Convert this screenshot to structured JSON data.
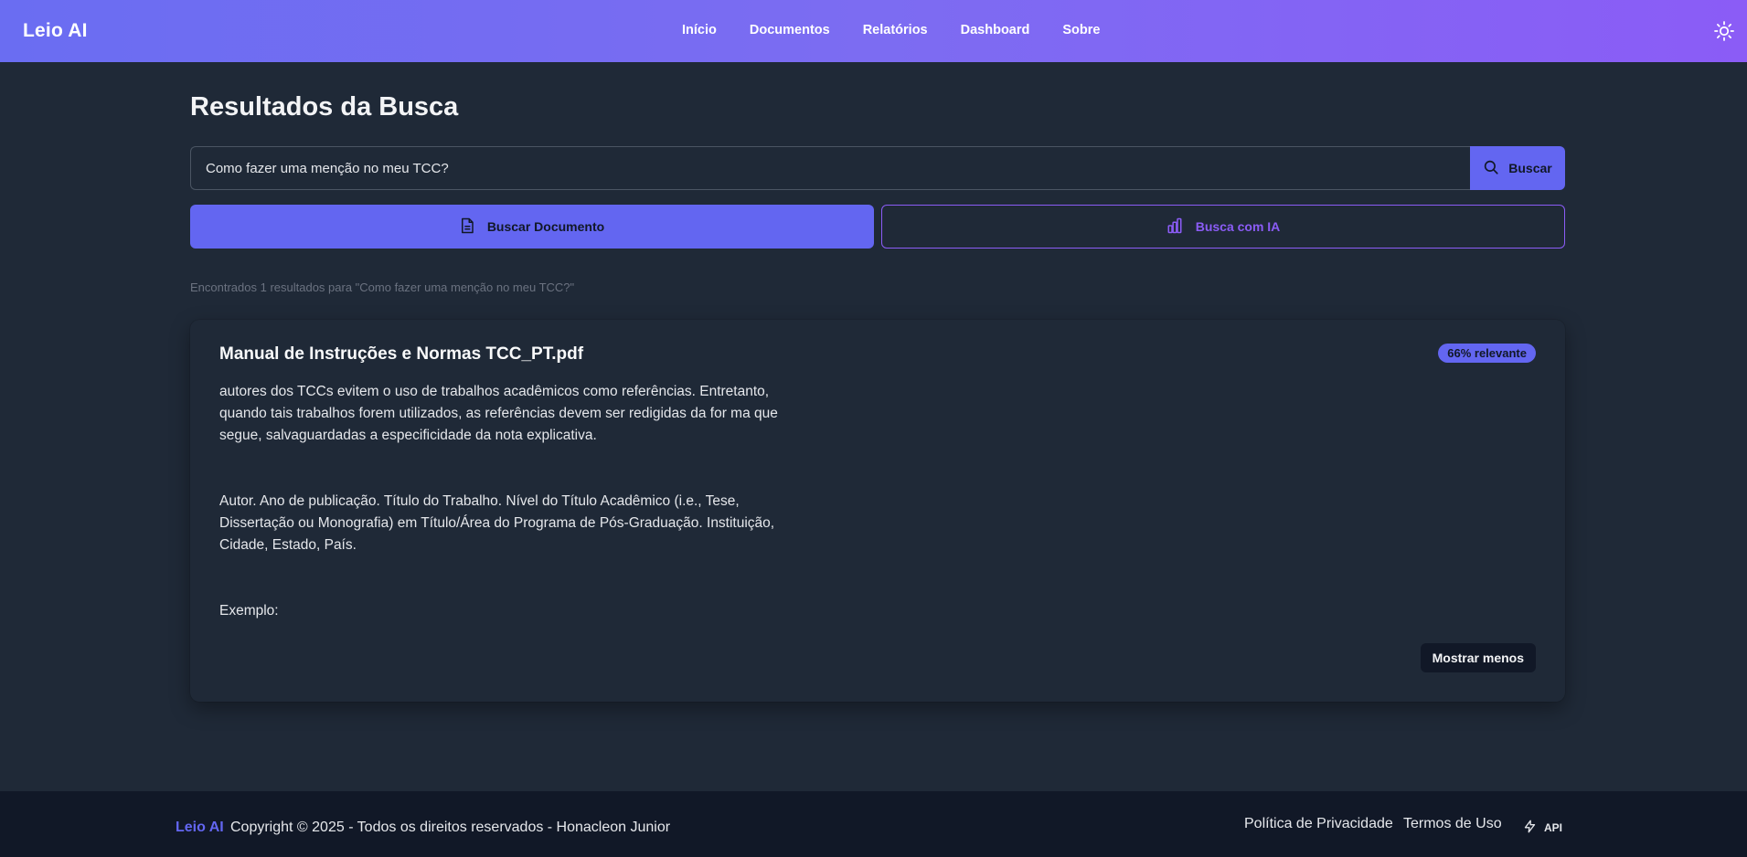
{
  "app": {
    "brand": "Leio AI",
    "nav": [
      "Início",
      "Documentos",
      "Relatórios",
      "Dashboard",
      "Sobre"
    ]
  },
  "page": {
    "title": "Resultados da Busca"
  },
  "search": {
    "value": "Como fazer uma menção no meu TCC?",
    "button_label": "Buscar"
  },
  "modes": {
    "document_label": "Buscar Documento",
    "ai_label": "Busca com IA"
  },
  "results": {
    "summary": "Encontrados 1 resultados para \"Como fazer uma menção no meu TCC?\"",
    "items": [
      {
        "title": "Manual de Instruções e Normas TCC_PT.pdf",
        "relevance": "66% relevante",
        "paragraphs": [
          "autores dos TCCs evitem o uso de trabalhos acadêmicos como referências. Entretanto, quando tais trabalhos forem utilizados, as referências devem ser redigidas da for ma que segue, salvaguardadas a especificidade da nota explicativa.",
          "Autor. Ano de publicação. Título do Trabalho. Nível do Título Acadêmico (i.e., Tese, Dissertação ou Monografia) em Título/Área do Programa de Pós-Graduação. Instituição, Cidade, Estado, País.",
          "Exemplo:"
        ],
        "toggle_label": "Mostrar menos"
      }
    ]
  },
  "footer": {
    "brand": "Leio AI",
    "copyright": "Copyright © 2025 - Todos os direitos reservados - Honacleon Junior",
    "links": [
      "Política de Privacidade",
      "Termos de Uso"
    ],
    "api_label": "API"
  },
  "colors": {
    "accent": "#6366f1",
    "accent_purple": "#8b5cf6",
    "background": "#1f2937",
    "footer_bg": "#111827"
  },
  "icons": {
    "theme": "sun-icon",
    "search": "search-icon",
    "document": "document-icon",
    "ai": "bar-chart-icon",
    "api": "lightning-icon"
  }
}
